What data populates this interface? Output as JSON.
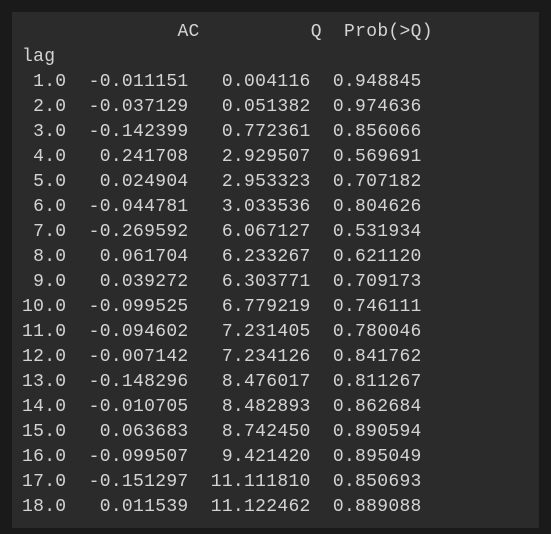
{
  "headers": {
    "ac": "AC",
    "q": "Q",
    "prob": "Prob(>Q)"
  },
  "index_label": "lag",
  "rows": [
    {
      "lag": "1.0",
      "ac": "-0.011151",
      "q": "0.004116",
      "prob": "0.948845"
    },
    {
      "lag": "2.0",
      "ac": "-0.037129",
      "q": "0.051382",
      "prob": "0.974636"
    },
    {
      "lag": "3.0",
      "ac": "-0.142399",
      "q": "0.772361",
      "prob": "0.856066"
    },
    {
      "lag": "4.0",
      "ac": " 0.241708",
      "q": "2.929507",
      "prob": "0.569691"
    },
    {
      "lag": "5.0",
      "ac": " 0.024904",
      "q": "2.953323",
      "prob": "0.707182"
    },
    {
      "lag": "6.0",
      "ac": "-0.044781",
      "q": "3.033536",
      "prob": "0.804626"
    },
    {
      "lag": "7.0",
      "ac": "-0.269592",
      "q": "6.067127",
      "prob": "0.531934"
    },
    {
      "lag": "8.0",
      "ac": " 0.061704",
      "q": "6.233267",
      "prob": "0.621120"
    },
    {
      "lag": "9.0",
      "ac": " 0.039272",
      "q": "6.303771",
      "prob": "0.709173"
    },
    {
      "lag": "10.0",
      "ac": "-0.099525",
      "q": "6.779219",
      "prob": "0.746111"
    },
    {
      "lag": "11.0",
      "ac": "-0.094602",
      "q": "7.231405",
      "prob": "0.780046"
    },
    {
      "lag": "12.0",
      "ac": "-0.007142",
      "q": "7.234126",
      "prob": "0.841762"
    },
    {
      "lag": "13.0",
      "ac": "-0.148296",
      "q": "8.476017",
      "prob": "0.811267"
    },
    {
      "lag": "14.0",
      "ac": "-0.010705",
      "q": "8.482893",
      "prob": "0.862684"
    },
    {
      "lag": "15.0",
      "ac": " 0.063683",
      "q": "8.742450",
      "prob": "0.890594"
    },
    {
      "lag": "16.0",
      "ac": "-0.099507",
      "q": "9.421420",
      "prob": "0.895049"
    },
    {
      "lag": "17.0",
      "ac": "-0.151297",
      "q": "11.111810",
      "prob": "0.850693"
    },
    {
      "lag": "18.0",
      "ac": " 0.011539",
      "q": "11.122462",
      "prob": "0.889088"
    }
  ]
}
